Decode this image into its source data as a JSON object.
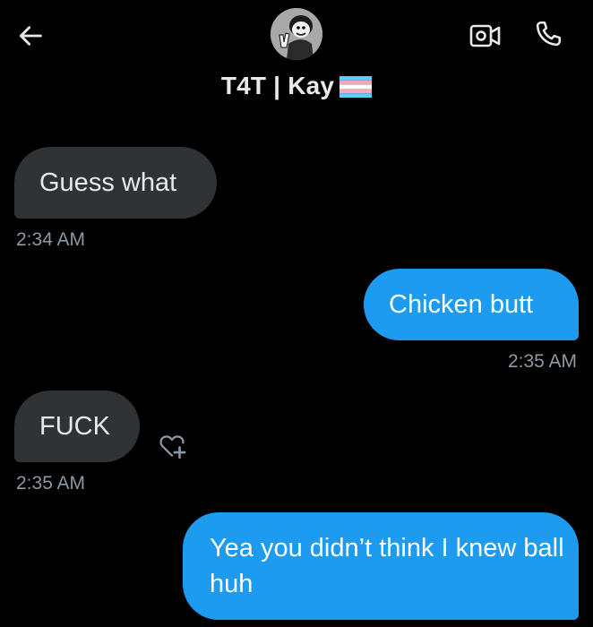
{
  "header": {
    "contact_name": "T4T | Kay",
    "back_icon": "arrow-left-icon",
    "video_icon": "video-call-icon",
    "call_icon": "phone-icon",
    "flag_icon": "transgender-flag-icon"
  },
  "messages": [
    {
      "direction": "incoming",
      "text": "Guess what",
      "time": "2:34 AM"
    },
    {
      "direction": "outgoing",
      "text": "Chicken butt",
      "time": "2:35 AM"
    },
    {
      "direction": "incoming",
      "text": "FUCK",
      "time": "2:35 AM"
    },
    {
      "direction": "outgoing",
      "text": "Yea you didn’t think I knew ball huh"
    }
  ],
  "colors": {
    "background": "#000000",
    "incoming_bubble": "#2f3336",
    "outgoing_bubble": "#1d9bf0",
    "text_primary": "#e7e9ea",
    "text_secondary": "#8b98a5",
    "flag_blue": "#5bcefa",
    "flag_pink": "#f5a9b8",
    "flag_white": "#ffffff"
  },
  "react_icon": "heart-plus-icon"
}
